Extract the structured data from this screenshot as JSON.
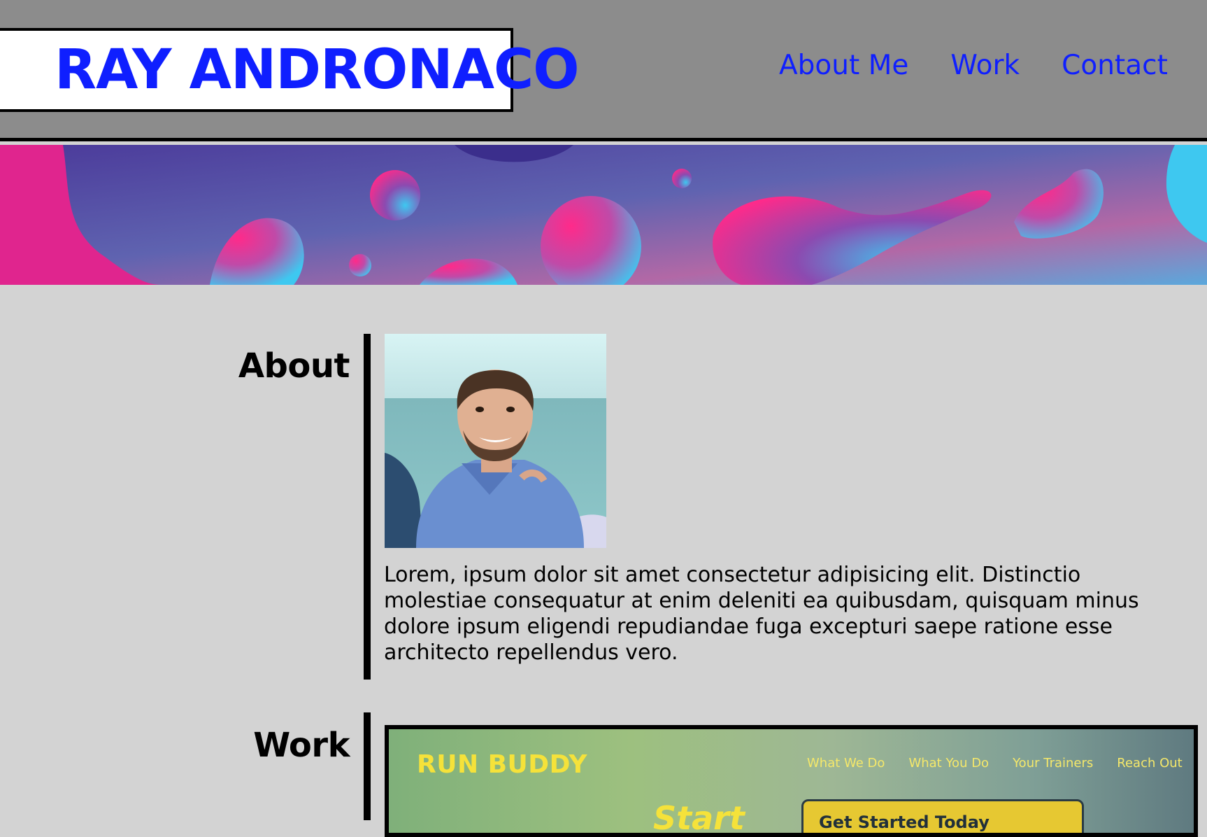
{
  "header": {
    "logo": "RAY ANDRONACO",
    "nav": [
      "About Me",
      "Work",
      "Contact"
    ]
  },
  "colors": {
    "link": "#0f1fff",
    "header_bg": "#8c8c8c",
    "page_bg": "#d3d3d3"
  },
  "about": {
    "title": "About",
    "photo_alt": "Portrait photo",
    "text": "Lorem, ipsum dolor sit amet consectetur adipisicing elit. Distinctio molestiae consequatur at enim deleniti ea quibusdam, quisquam minus dolore ipsum eligendi repudiandae fuga excepturi saepe ratione esse architecto repellendus vero."
  },
  "work": {
    "title": "Work",
    "preview": {
      "logo": "RUN BUDDY",
      "nav": [
        "What We Do",
        "What You Do",
        "Your Trainers",
        "Reach Out"
      ],
      "headline": "Start",
      "cta": "Get Started Today"
    }
  }
}
